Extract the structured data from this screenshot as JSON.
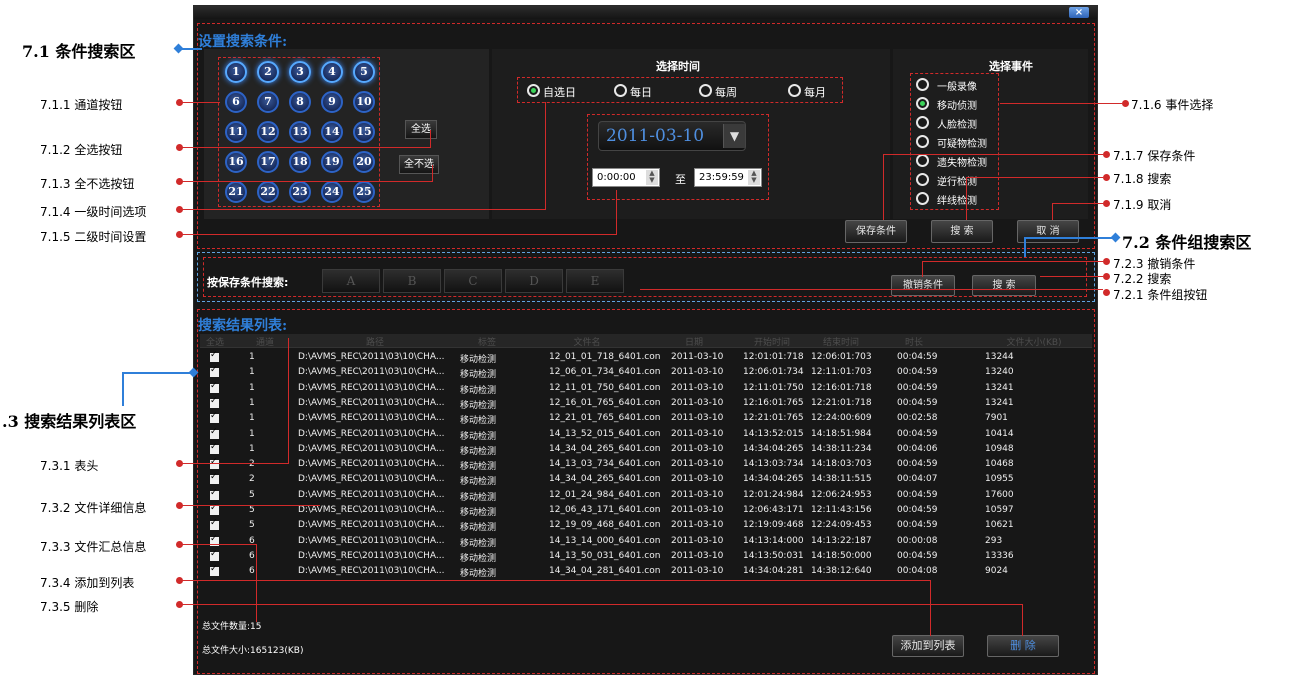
{
  "annotations_left": [
    {
      "id": "7.1",
      "text": "7.1 条件搜索区"
    },
    {
      "id": "7.1.1",
      "text": "7.1.1 通道按钮"
    },
    {
      "id": "7.1.2",
      "text": "7.1.2 全选按钮"
    },
    {
      "id": "7.1.3",
      "text": "7.1.3 全不选按钮"
    },
    {
      "id": "7.1.4",
      "text": "7.1.4 一级时间选项"
    },
    {
      "id": "7.1.5",
      "text": "7.1.5 二级时间设置"
    },
    {
      "id": "7.3",
      "text": ".3 搜索结果列表区"
    },
    {
      "id": "7.3.1",
      "text": "7.3.1 表头"
    },
    {
      "id": "7.3.2",
      "text": "7.3.2 文件详细信息"
    },
    {
      "id": "7.3.3",
      "text": "7.3.3 文件汇总信息"
    },
    {
      "id": "7.3.4",
      "text": "7.3.4 添加到列表"
    },
    {
      "id": "7.3.5",
      "text": "7.3.5 删除"
    }
  ],
  "annotations_right": [
    {
      "id": "7.1.6",
      "text": "7.1.6 事件选择"
    },
    {
      "id": "7.1.7",
      "text": "7.1.7 保存条件"
    },
    {
      "id": "7.1.8",
      "text": "7.1.8 搜索"
    },
    {
      "id": "7.1.9",
      "text": "7.1.9 取消"
    },
    {
      "id": "7.2",
      "text": "7.2 条件组搜索区"
    },
    {
      "id": "7.2.3",
      "text": "7.2.3 撤销条件"
    },
    {
      "id": "7.2.2",
      "text": "7.2.2 搜索"
    },
    {
      "id": "7.2.1",
      "text": "7.2.1 条件组按钮"
    }
  ],
  "window": {
    "close_label": "×"
  },
  "condition": {
    "title": "设置搜索条件:",
    "channels": [
      "1",
      "2",
      "3",
      "4",
      "5",
      "6",
      "7",
      "8",
      "9",
      "10",
      "11",
      "12",
      "13",
      "14",
      "15",
      "16",
      "17",
      "18",
      "19",
      "20",
      "21",
      "22",
      "23",
      "24",
      "25"
    ],
    "select_all": "全选",
    "select_none": "全不选",
    "time_header": "选择时间",
    "time_options": [
      "自选日",
      "每日",
      "每周",
      "每月"
    ],
    "date_value": "2011-03-10",
    "time_from": "0:00:00",
    "time_to_label": "至",
    "time_to": "23:59:59",
    "event_header": "选择事件",
    "events": [
      "一般录像",
      "移动侦测",
      "人脸检测",
      "可疑物检测",
      "遗失物检测",
      "逆行检测",
      "绊线检测"
    ],
    "save_btn": "保存条件",
    "search_btn": "搜 索",
    "cancel_btn": "取 消"
  },
  "group_search": {
    "label": "按保存条件搜索:",
    "groups": [
      "A",
      "B",
      "C",
      "D",
      "E"
    ],
    "revoke_btn": "撤销条件",
    "search_btn": "搜 索"
  },
  "results": {
    "title": "搜索结果列表:",
    "headers": [
      "全选",
      "通道",
      "路径",
      "标签",
      "文件名",
      "日期",
      "开始时间",
      "结束时间",
      "时长",
      "文件大小(KB)"
    ],
    "rows": [
      [
        "1",
        "D:\\AVMS_REC\\2011\\03\\10\\CHA...",
        "移动检测",
        "12_01_01_718_6401.con",
        "2011-03-10",
        "12:01:01:718",
        "12:06:01:703",
        "00:04:59",
        "13244"
      ],
      [
        "1",
        "D:\\AVMS_REC\\2011\\03\\10\\CHA...",
        "移动检测",
        "12_06_01_734_6401.con",
        "2011-03-10",
        "12:06:01:734",
        "12:11:01:703",
        "00:04:59",
        "13240"
      ],
      [
        "1",
        "D:\\AVMS_REC\\2011\\03\\10\\CHA...",
        "移动检测",
        "12_11_01_750_6401.con",
        "2011-03-10",
        "12:11:01:750",
        "12:16:01:718",
        "00:04:59",
        "13241"
      ],
      [
        "1",
        "D:\\AVMS_REC\\2011\\03\\10\\CHA...",
        "移动检测",
        "12_16_01_765_6401.con",
        "2011-03-10",
        "12:16:01:765",
        "12:21:01:718",
        "00:04:59",
        "13241"
      ],
      [
        "1",
        "D:\\AVMS_REC\\2011\\03\\10\\CHA...",
        "移动检测",
        "12_21_01_765_6401.con",
        "2011-03-10",
        "12:21:01:765",
        "12:24:00:609",
        "00:02:58",
        "7901"
      ],
      [
        "1",
        "D:\\AVMS_REC\\2011\\03\\10\\CHA...",
        "移动检测",
        "14_13_52_015_6401.con",
        "2011-03-10",
        "14:13:52:015",
        "14:18:51:984",
        "00:04:59",
        "10414"
      ],
      [
        "1",
        "D:\\AVMS_REC\\2011\\03\\10\\CHA...",
        "移动检测",
        "14_34_04_265_6401.con",
        "2011-03-10",
        "14:34:04:265",
        "14:38:11:234",
        "00:04:06",
        "10948"
      ],
      [
        "2",
        "D:\\AVMS_REC\\2011\\03\\10\\CHA...",
        "移动检测",
        "14_13_03_734_6401.con",
        "2011-03-10",
        "14:13:03:734",
        "14:18:03:703",
        "00:04:59",
        "10468"
      ],
      [
        "2",
        "D:\\AVMS_REC\\2011\\03\\10\\CHA...",
        "移动检测",
        "14_34_04_265_6401.con",
        "2011-03-10",
        "14:34:04:265",
        "14:38:11:515",
        "00:04:07",
        "10955"
      ],
      [
        "5",
        "D:\\AVMS_REC\\2011\\03\\10\\CHA...",
        "移动检测",
        "12_01_24_984_6401.con",
        "2011-03-10",
        "12:01:24:984",
        "12:06:24:953",
        "00:04:59",
        "17600"
      ],
      [
        "5",
        "D:\\AVMS_REC\\2011\\03\\10\\CHA...",
        "移动检测",
        "12_06_43_171_6401.con",
        "2011-03-10",
        "12:06:43:171",
        "12:11:43:156",
        "00:04:59",
        "10597"
      ],
      [
        "5",
        "D:\\AVMS_REC\\2011\\03\\10\\CHA...",
        "移动检测",
        "12_19_09_468_6401.con",
        "2011-03-10",
        "12:19:09:468",
        "12:24:09:453",
        "00:04:59",
        "10621"
      ],
      [
        "6",
        "D:\\AVMS_REC\\2011\\03\\10\\CHA...",
        "移动检测",
        "14_13_14_000_6401.con",
        "2011-03-10",
        "14:13:14:000",
        "14:13:22:187",
        "00:00:08",
        "293"
      ],
      [
        "6",
        "D:\\AVMS_REC\\2011\\03\\10\\CHA...",
        "移动检测",
        "14_13_50_031_6401.con",
        "2011-03-10",
        "14:13:50:031",
        "14:18:50:000",
        "00:04:59",
        "13336"
      ],
      [
        "6",
        "D:\\AVMS_REC\\2011\\03\\10\\CHA...",
        "移动检测",
        "14_34_04_281_6401.con",
        "2011-03-10",
        "14:34:04:281",
        "14:38:12:640",
        "00:04:08",
        "9024"
      ]
    ],
    "total_count": "总文件数量:15",
    "total_size": "总文件大小:165123(KB)",
    "add_btn": "添加到列表",
    "delete_btn": "删 除"
  }
}
